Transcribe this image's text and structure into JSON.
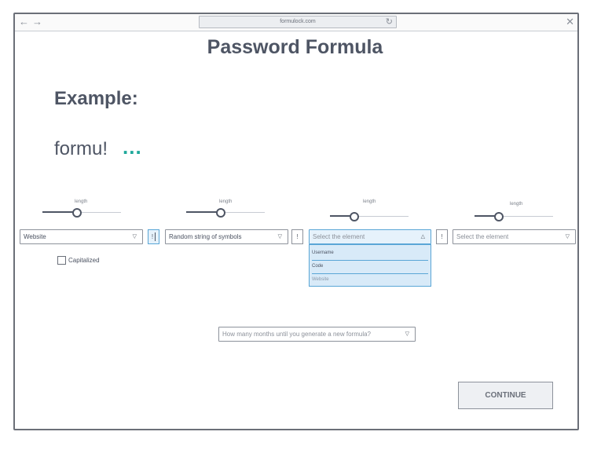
{
  "browser": {
    "url": "formulock.com"
  },
  "page": {
    "title": "Password Formula",
    "example_label": "Example:",
    "example_value": "formu!",
    "example_dots": "..."
  },
  "sliders": [
    {
      "label": "length",
      "value_fraction": 0.44
    },
    {
      "label": "length",
      "value_fraction": 0.44
    },
    {
      "label": "length",
      "value_fraction": 0.31
    },
    {
      "label": "length",
      "value_fraction": 0.31
    }
  ],
  "elements": [
    {
      "value": "Website"
    },
    {
      "value": "Random string of symbols"
    },
    {
      "placeholder": "Select the element",
      "open": true
    },
    {
      "placeholder": "Select the element"
    }
  ],
  "separators": [
    "!",
    "!",
    "!"
  ],
  "capitalized": {
    "label": "Capitalized",
    "checked": false
  },
  "dropdown_options": [
    "Username",
    "Code",
    "Website"
  ],
  "months_select": {
    "placeholder": "How many months until you generate a new formula?"
  },
  "continue_button": {
    "label": "CONTINUE"
  },
  "icons": [
    "back-arrow-icon",
    "forward-arrow-icon",
    "reload-icon",
    "close-icon",
    "chevron-down-icon",
    "chevron-up-icon"
  ],
  "colors": {
    "accent": "#1fa89b",
    "highlight": "#5aa6d6",
    "text": "#4e5564"
  }
}
